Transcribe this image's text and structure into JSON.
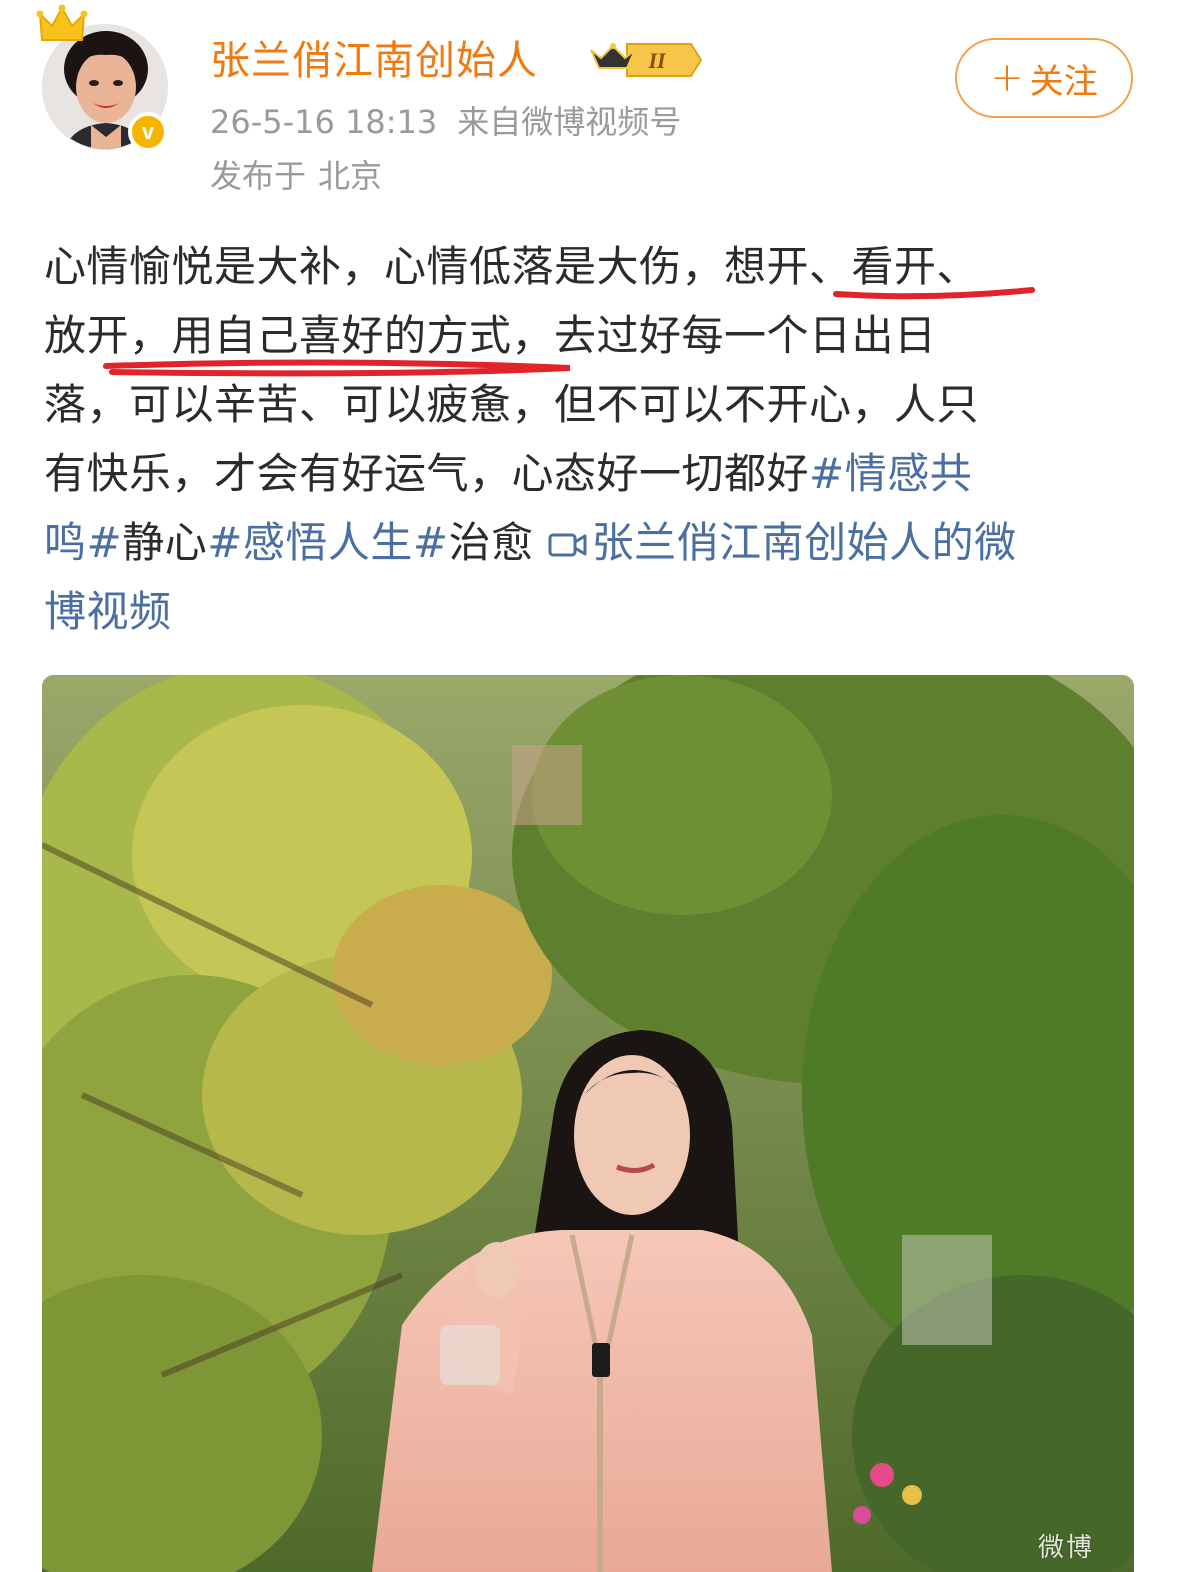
{
  "header": {
    "username": "张兰俏江南创始人",
    "level_badge": "II",
    "timestamp": "26-5-16 18:13",
    "source": "来自微博视频号",
    "location_label": "发布于",
    "location": "北京",
    "follow_label": "关注",
    "verified_mark": "v"
  },
  "post": {
    "line1_a": "心情愉悦是大补，心情低落是大伤，",
    "line1_b": "想开、看开、",
    "line2_a": "放开，",
    "line2_b": "用自己喜好的方式，",
    "line2_c": "去过好每一个日出日",
    "line3": "落，可以辛苦、可以疲惫，但不可以不开心，人只",
    "line4_text": "有快乐，才会有好运气，心态好一切都好",
    "tag1_line4": "#情感共",
    "tag1_line5": "鸣#",
    "plain_word1": "静心",
    "tag2": "#感悟人生#",
    "plain_word2": "治愈",
    "video_link_line5": "张兰俏江南创始人的微",
    "video_link_line6": "博视频"
  },
  "media": {
    "watermark": "微博"
  },
  "colors": {
    "username": "#f07a10",
    "link": "#4a6fa0",
    "text": "#2b2b2b",
    "meta": "#9a9a9a",
    "underline": "#e0242a"
  }
}
